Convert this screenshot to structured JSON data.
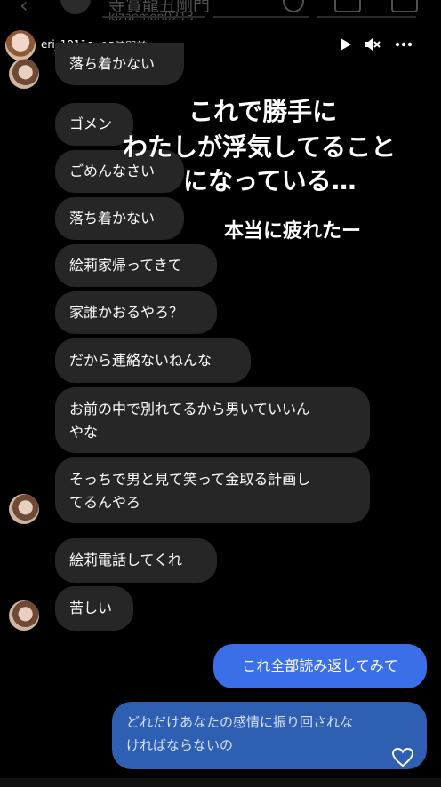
{
  "background_chat": {
    "name": "寺賞龍丑剛門",
    "subtitle": "kizaemon0213"
  },
  "story": {
    "username": "eri_1011s",
    "time": "15時間前"
  },
  "messages": [
    {
      "text": "落ち着かない"
    },
    {
      "text": "ゴメン"
    },
    {
      "text": "ごめんなさい"
    },
    {
      "text": "落ち着かない"
    },
    {
      "text": "絵莉家帰ってきて"
    },
    {
      "text": "家誰かおるやろ？"
    },
    {
      "text": "だから連絡ないねんな"
    },
    {
      "line1": "お前の中で別れてるから男いていいん",
      "line2": "やな"
    },
    {
      "line1": "そっちで男と見て笑って金取る計画し",
      "line2": "てるんやろ"
    },
    {
      "text": "絵莉電話してくれ"
    },
    {
      "text": "苦しい"
    }
  ],
  "sent": {
    "msg1": "これ全部読み返してみて",
    "msg2_line1": "どれだけあなたの感情に振り回されな",
    "msg2_line2": "ければならないの"
  },
  "overlay": {
    "line1": "これで勝手に",
    "line2": "わたしが浮気してること",
    "line3": "になっている…",
    "line4": "本当に疲れたー"
  },
  "colors": {
    "sent_bubble": "#3a6fe8",
    "received_bubble": "#262626"
  }
}
